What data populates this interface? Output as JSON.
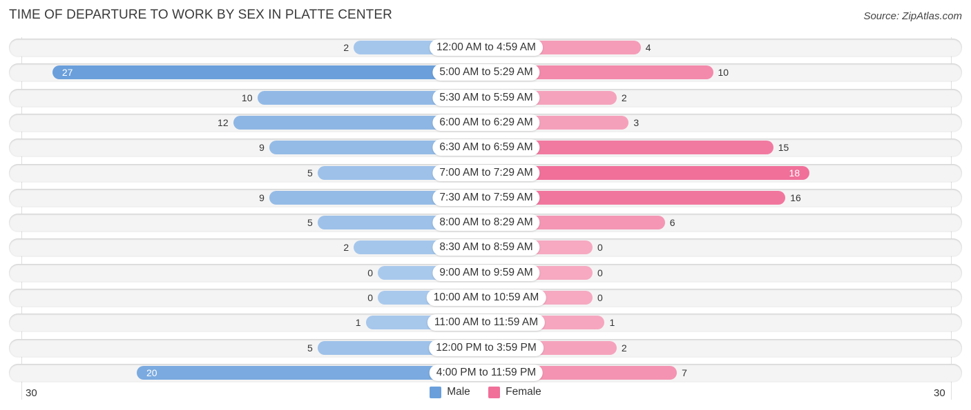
{
  "title": "TIME OF DEPARTURE TO WORK BY SEX IN PLATTE CENTER",
  "source": "Source: ZipAtlas.com",
  "colors": {
    "male": "#6a9fdb",
    "male_light": "#a9c9ec",
    "female": "#f0709a",
    "female_light": "#f6a9c1"
  },
  "chart_data": {
    "type": "bar",
    "orientation": "horizontal-diverging",
    "title": "TIME OF DEPARTURE TO WORK BY SEX IN PLATTE CENTER",
    "categories": [
      "12:00 AM to 4:59 AM",
      "5:00 AM to 5:29 AM",
      "5:30 AM to 5:59 AM",
      "6:00 AM to 6:29 AM",
      "6:30 AM to 6:59 AM",
      "7:00 AM to 7:29 AM",
      "7:30 AM to 7:59 AM",
      "8:00 AM to 8:29 AM",
      "8:30 AM to 8:59 AM",
      "9:00 AM to 9:59 AM",
      "10:00 AM to 10:59 AM",
      "11:00 AM to 11:59 AM",
      "12:00 PM to 3:59 PM",
      "4:00 PM to 11:59 PM"
    ],
    "series": [
      {
        "name": "Male",
        "values": [
          2,
          27,
          10,
          12,
          9,
          5,
          9,
          5,
          2,
          0,
          0,
          1,
          5,
          20
        ]
      },
      {
        "name": "Female",
        "values": [
          4,
          10,
          2,
          3,
          15,
          18,
          16,
          6,
          0,
          0,
          0,
          1,
          2,
          7
        ]
      }
    ],
    "axis": {
      "left_label": "30",
      "right_label": "30",
      "range": [
        0,
        30
      ]
    },
    "legend": {
      "position": "bottom-center",
      "entries": [
        "Male",
        "Female"
      ]
    },
    "grid": false
  }
}
